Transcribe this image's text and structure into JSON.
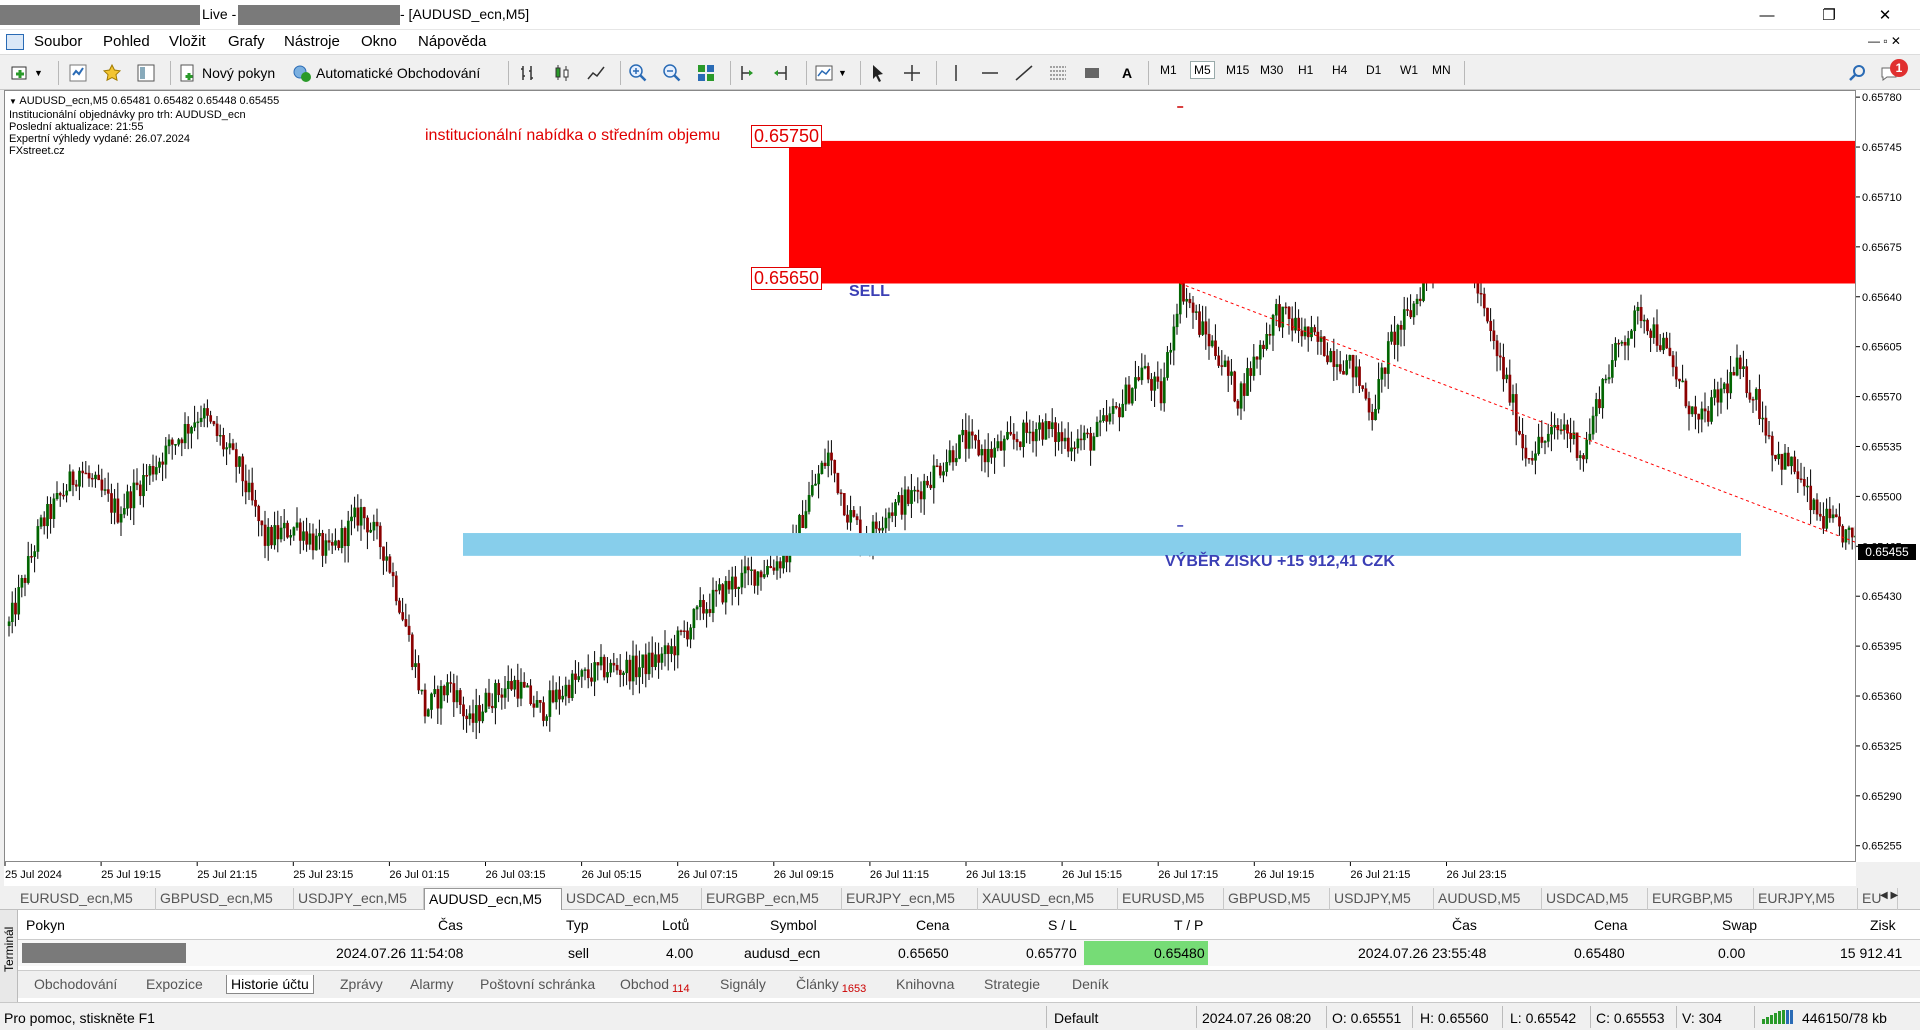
{
  "window": {
    "title_live": "Live -",
    "title_chart": "- [AUDUSD_ecn,M5]",
    "minimize": "—",
    "maximize": "❐",
    "close": "✕"
  },
  "menu": [
    "Soubor",
    "Pohled",
    "Vložit",
    "Grafy",
    "Nástroje",
    "Okno",
    "Nápověda"
  ],
  "toolbar": {
    "new_order": "Nový pokyn",
    "auto_trading": "Automatické Obchodování",
    "text_tool": "A",
    "timeframes": [
      "M1",
      "M5",
      "M15",
      "M30",
      "H1",
      "H4",
      "D1",
      "W1",
      "MN"
    ],
    "active_timeframe": "M5",
    "notification_count": "1"
  },
  "chart": {
    "header": "AUDUSD_ecn,M5  0.65481 0.65482 0.65448 0.65455",
    "info_lines": [
      "Institucionální objednávky pro trh: AUDUSD_ecn",
      "Poslední aktualizace: 21:55",
      "Expertní výhledy vydané: 26.07.2024",
      "FXstreet.cz"
    ],
    "zone_label": "institucionální nabídka o středním objemu",
    "zone_top_label": "0.65750",
    "zone_bottom_label": "0.65650",
    "sell_label": "SELL",
    "profit_label": "VÝBĚR ZISKU +15 912,41 CZK",
    "current_price": "0.65455",
    "colors": {
      "zone": "#ff0000",
      "target": "#87ceeb",
      "bull": "#006400",
      "bear": "#8b0000"
    }
  },
  "chart_data": {
    "type": "candlestick",
    "symbol": "AUDUSD_ecn",
    "timeframe": "M5",
    "y_ticks": [
      "0.65780",
      "0.65745",
      "0.65710",
      "0.65675",
      "0.65640",
      "0.65605",
      "0.65570",
      "0.65535",
      "0.65500",
      "0.65465",
      "0.65430",
      "0.65395",
      "0.65360",
      "0.65325",
      "0.65290",
      "0.65255"
    ],
    "x_ticks": [
      "25 Jul 2024",
      "25 Jul 19:15",
      "25 Jul 21:15",
      "25 Jul 23:15",
      "26 Jul 01:15",
      "26 Jul 03:15",
      "26 Jul 05:15",
      "26 Jul 07:15",
      "26 Jul 09:15",
      "26 Jul 11:15",
      "26 Jul 13:15",
      "26 Jul 15:15",
      "26 Jul 17:15",
      "26 Jul 19:15",
      "26 Jul 21:15",
      "26 Jul 23:15"
    ],
    "ylim": [
      0.65245,
      0.65785
    ],
    "supply_zone": [
      0.6565,
      0.6575
    ],
    "target_zone": [
      0.65459,
      0.65475
    ],
    "path": [
      [
        0,
        0.6541
      ],
      [
        10,
        0.6548
      ],
      [
        22,
        0.6552
      ],
      [
        34,
        0.6549
      ],
      [
        48,
        0.6553
      ],
      [
        60,
        0.6556
      ],
      [
        72,
        0.6552
      ],
      [
        80,
        0.6547
      ],
      [
        90,
        0.6548
      ],
      [
        100,
        0.6546
      ],
      [
        110,
        0.6549
      ],
      [
        118,
        0.6546
      ],
      [
        124,
        0.6541
      ],
      [
        130,
        0.6535
      ],
      [
        138,
        0.6537
      ],
      [
        144,
        0.6534
      ],
      [
        150,
        0.6536
      ],
      [
        158,
        0.6537
      ],
      [
        166,
        0.6535
      ],
      [
        176,
        0.6537
      ],
      [
        186,
        0.6538
      ],
      [
        196,
        0.6538
      ],
      [
        206,
        0.6539
      ],
      [
        216,
        0.6542
      ],
      [
        226,
        0.6544
      ],
      [
        236,
        0.6545
      ],
      [
        244,
        0.6546
      ],
      [
        250,
        0.655
      ],
      [
        256,
        0.6553
      ],
      [
        262,
        0.6549
      ],
      [
        268,
        0.6547
      ],
      [
        274,
        0.6549
      ],
      [
        282,
        0.655
      ],
      [
        290,
        0.6552
      ],
      [
        298,
        0.6554
      ],
      [
        306,
        0.6553
      ],
      [
        314,
        0.6554
      ],
      [
        322,
        0.6555
      ],
      [
        330,
        0.6554
      ],
      [
        338,
        0.6554
      ],
      [
        346,
        0.6556
      ],
      [
        354,
        0.6559
      ],
      [
        360,
        0.6557
      ],
      [
        366,
        0.6565
      ],
      [
        372,
        0.6562
      ],
      [
        378,
        0.656
      ],
      [
        384,
        0.6557
      ],
      [
        390,
        0.656
      ],
      [
        396,
        0.6563
      ],
      [
        402,
        0.6562
      ],
      [
        408,
        0.6561
      ],
      [
        414,
        0.656
      ],
      [
        420,
        0.6559
      ],
      [
        426,
        0.6556
      ],
      [
        432,
        0.6561
      ],
      [
        438,
        0.6563
      ],
      [
        444,
        0.6566
      ],
      [
        450,
        0.6568
      ],
      [
        456,
        0.6567
      ],
      [
        462,
        0.6562
      ],
      [
        468,
        0.6558
      ],
      [
        474,
        0.6553
      ],
      [
        480,
        0.6554
      ],
      [
        486,
        0.6555
      ],
      [
        492,
        0.6553
      ],
      [
        498,
        0.6558
      ],
      [
        504,
        0.6561
      ],
      [
        510,
        0.6563
      ],
      [
        516,
        0.6561
      ],
      [
        522,
        0.6558
      ],
      [
        528,
        0.6555
      ],
      [
        534,
        0.6557
      ],
      [
        540,
        0.6559
      ],
      [
        546,
        0.6557
      ],
      [
        552,
        0.6553
      ],
      [
        558,
        0.6552
      ],
      [
        564,
        0.6549
      ],
      [
        570,
        0.6548
      ],
      [
        576,
        0.6547
      ],
      [
        580,
        0.6545
      ],
      [
        582,
        0.65455
      ]
    ],
    "trade_line": {
      "from": [
        366,
        0.6565
      ],
      "to": [
        580,
        0.65466
      ]
    }
  },
  "symbol_tabs": [
    "EURUSD_ecn,M5",
    "GBPUSD_ecn,M5",
    "USDJPY_ecn,M5",
    "AUDUSD_ecn,M5",
    "USDCAD_ecn,M5",
    "EURGBP_ecn,M5",
    "EURJPY_ecn,M5",
    "XAUUSD_ecn,M5",
    "EURUSD,M5",
    "GBPUSD,M5",
    "USDJPY,M5",
    "AUDUSD,M5",
    "USDCAD,M5",
    "EURGBP,M5",
    "EURJPY,M5",
    "EU"
  ],
  "active_symbol_tab": "AUDUSD_ecn,M5",
  "terminal": {
    "side_label": "Terminál",
    "headers": {
      "order": "Pokyn",
      "time_open": "Čas",
      "type": "Typ",
      "lots": "Lotů",
      "symbol": "Symbol",
      "price_open": "Cena",
      "sl": "S / L",
      "tp": "T / P",
      "time_close": "Čas",
      "price_close": "Cena",
      "swap": "Swap",
      "profit": "Zisk"
    },
    "row": {
      "time_open": "2024.07.26 11:54:08",
      "type": "sell",
      "lots": "4.00",
      "symbol": "audusd_ecn",
      "price_open": "0.65650",
      "sl": "0.65770",
      "tp": "0.65480",
      "time_close": "2024.07.26 23:55:48",
      "price_close": "0.65480",
      "swap": "0.00",
      "profit": "15 912.41"
    },
    "tabs": [
      {
        "label": "Obchodování",
        "badge": ""
      },
      {
        "label": "Expozice",
        "badge": ""
      },
      {
        "label": "Historie účtu",
        "badge": ""
      },
      {
        "label": "Zprávy",
        "badge": ""
      },
      {
        "label": "Alarmy",
        "badge": ""
      },
      {
        "label": "Poštovní schránka",
        "badge": ""
      },
      {
        "label": "Obchod",
        "badge": "114"
      },
      {
        "label": "Signály",
        "badge": ""
      },
      {
        "label": "Články",
        "badge": "1653"
      },
      {
        "label": "Knihovna",
        "badge": ""
      },
      {
        "label": "Strategie",
        "badge": ""
      },
      {
        "label": "Deník",
        "badge": ""
      }
    ],
    "active_tab": "Historie účtu"
  },
  "status": {
    "help": "Pro pomoc, stiskněte F1",
    "profile": "Default",
    "datetime": "2024.07.26 08:20",
    "open": "O: 0.65551",
    "high": "H: 0.65560",
    "low": "L: 0.65542",
    "close": "C: 0.65553",
    "volume": "V: 304",
    "traffic": "446150/78 kb"
  }
}
